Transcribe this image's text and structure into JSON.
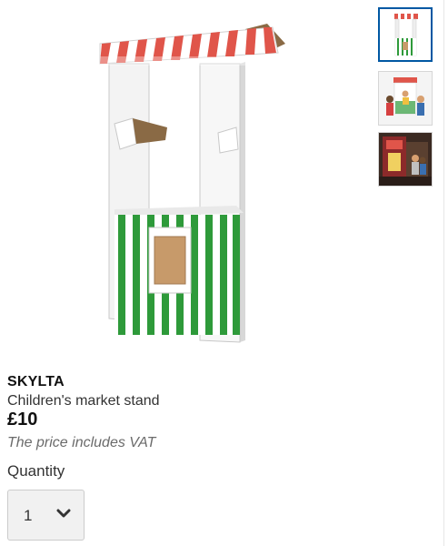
{
  "product": {
    "name": "SKYLTA",
    "description": "Children's market stand",
    "price": "£10",
    "vat_note": "The price includes VAT"
  },
  "quantity": {
    "label": "Quantity",
    "selected": "1"
  },
  "gallery": {
    "selected_index": 0,
    "thumbnails": [
      {
        "icon": "market-stand-product-thumbnail"
      },
      {
        "icon": "children-playing-market-stand-thumbnail"
      },
      {
        "icon": "decorated-market-stand-room-thumbnail"
      }
    ]
  },
  "colors": {
    "accent_border": "#0058a3",
    "awning_red": "#e0554a",
    "stripe_green": "#2e9a3a",
    "select_bg": "#f1f1f1"
  }
}
